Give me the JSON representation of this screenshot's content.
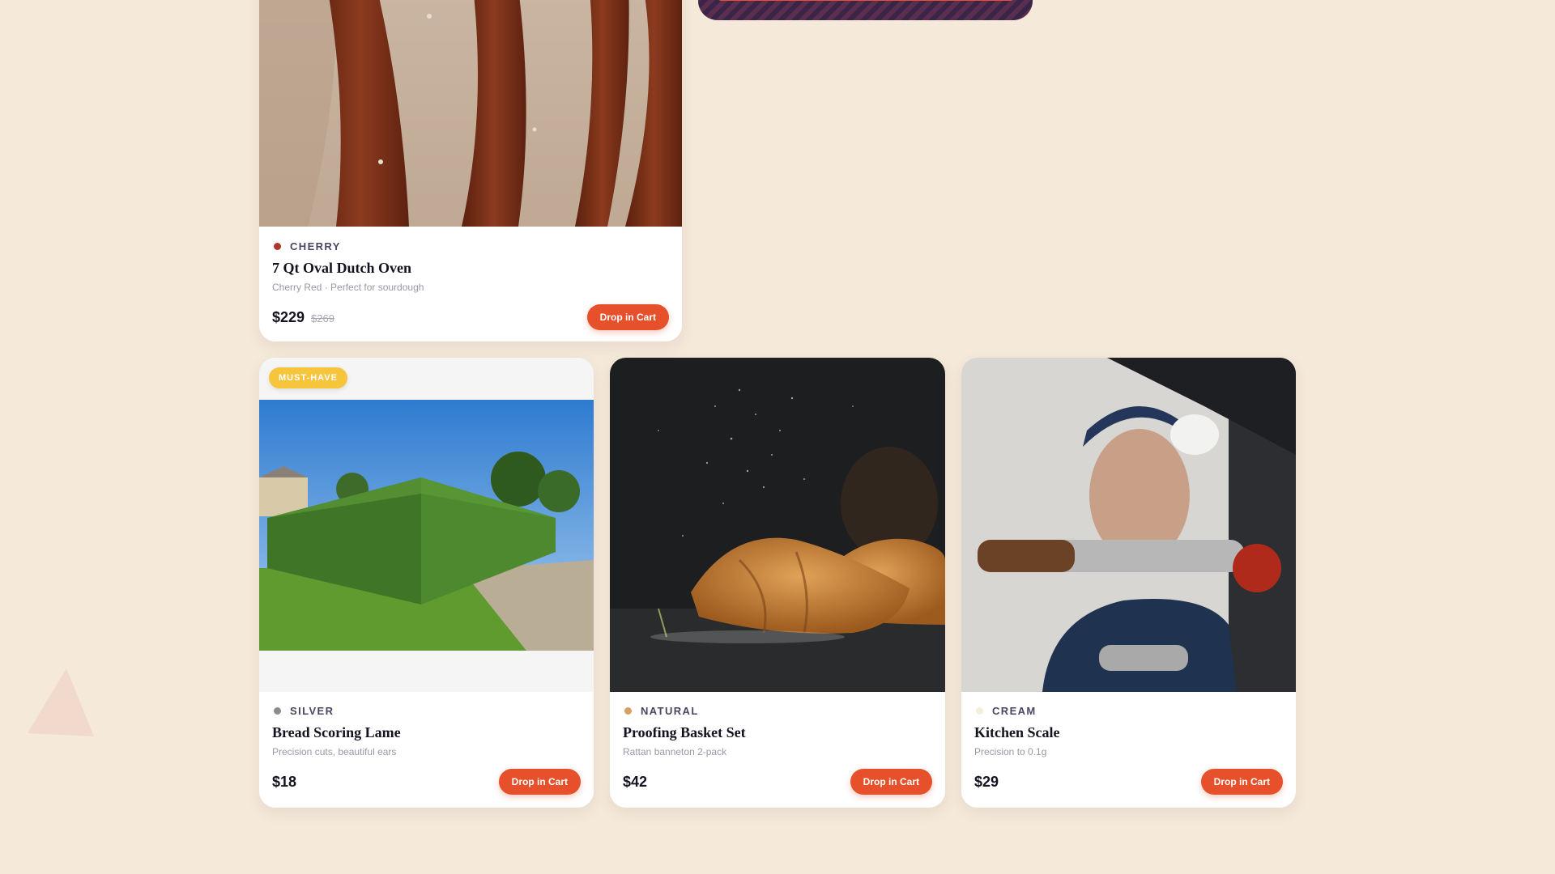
{
  "featured": {
    "color_name": "CHERRY",
    "dot_color": "#b3342d",
    "title": "7 Qt Oval Dutch Oven",
    "description": "Cherry Red · Perfect for sourdough",
    "price": "$229",
    "old_price": "$269",
    "button": "Drop in Cart"
  },
  "products": [
    {
      "badge": "MUST-HAVE",
      "color_name": "SILVER",
      "dot_color": "#8c8c8c",
      "title": "Bread Scoring Lame",
      "description": "Precision cuts, beautiful ears",
      "price": "$18",
      "button": "Drop in Cart"
    },
    {
      "color_name": "NATURAL",
      "dot_color": "#d5a060",
      "title": "Proofing Basket Set",
      "description": "Rattan banneton 2-pack",
      "price": "$42",
      "button": "Drop in Cart"
    },
    {
      "color_name": "CREAM",
      "dot_color": "#f6eedc",
      "title": "Kitchen Scale",
      "description": "Precision to 0.1g",
      "price": "$29",
      "button": "Drop in Cart"
    }
  ],
  "colors": {
    "background": "#f5e9da",
    "accent": "#e6502a",
    "badge": "#f7c53b"
  }
}
